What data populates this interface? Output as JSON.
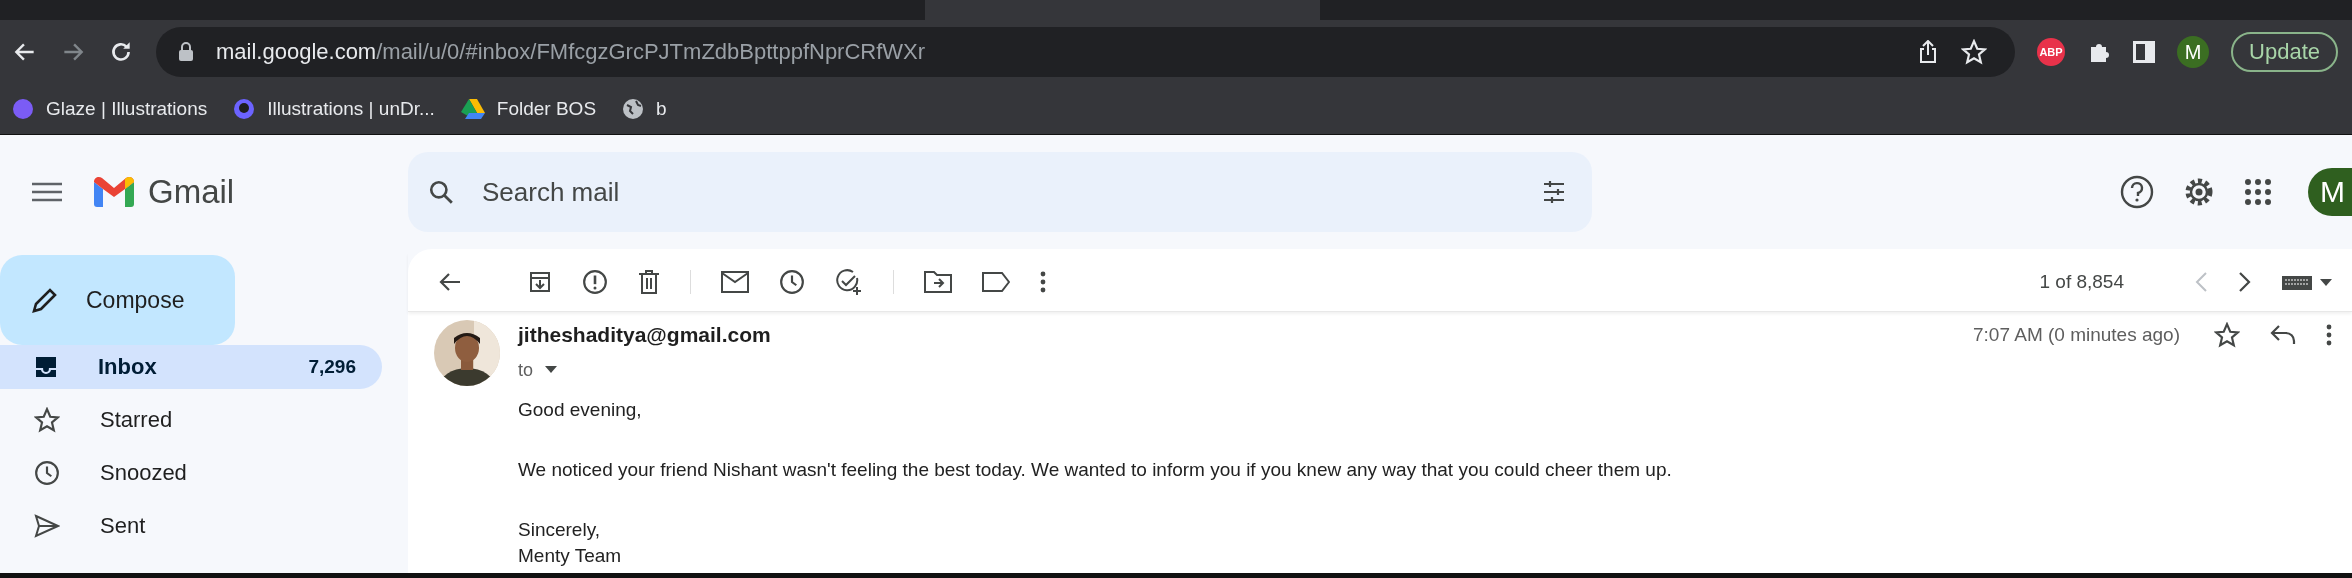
{
  "browser": {
    "url_host": "mail.google.com",
    "url_path": "/mail/u/0/#inbox/FMfcgzGrcPJTmZdbBpttppfNprCRfWXr",
    "extension_badge": "ABP",
    "profile_initial": "M",
    "update_button": "Update",
    "bookmarks": [
      {
        "label": "Glaze | Illustrations",
        "kind": "dot"
      },
      {
        "label": "Illustrations | unDr...",
        "kind": "undraw"
      },
      {
        "label": "Folder BOS",
        "kind": "drive"
      },
      {
        "label": "b",
        "kind": "globe"
      }
    ]
  },
  "gmail": {
    "logo_text": "Gmail",
    "search": {
      "placeholder": "Search mail"
    },
    "account_initial": "M",
    "compose": "Compose",
    "nav": [
      {
        "label": "Inbox",
        "count": "7,296",
        "selected": true,
        "kind": "inbox"
      },
      {
        "label": "Starred",
        "selected": false,
        "kind": "star"
      },
      {
        "label": "Snoozed",
        "selected": false,
        "kind": "clock"
      },
      {
        "label": "Sent",
        "selected": false,
        "kind": "send"
      }
    ],
    "pager": "1 of 8,854",
    "message": {
      "sender": "jitheshaditya@gmail.com",
      "to": "to",
      "time": "7:07 AM (0 minutes ago)",
      "body": [
        "Good evening,",
        "We noticed your friend Nishant wasn't feeling the best today. We wanted to inform you if you knew any way that you could cheer them up."
      ],
      "closing": "Sincerely,",
      "signature": "Menty Team"
    }
  }
}
